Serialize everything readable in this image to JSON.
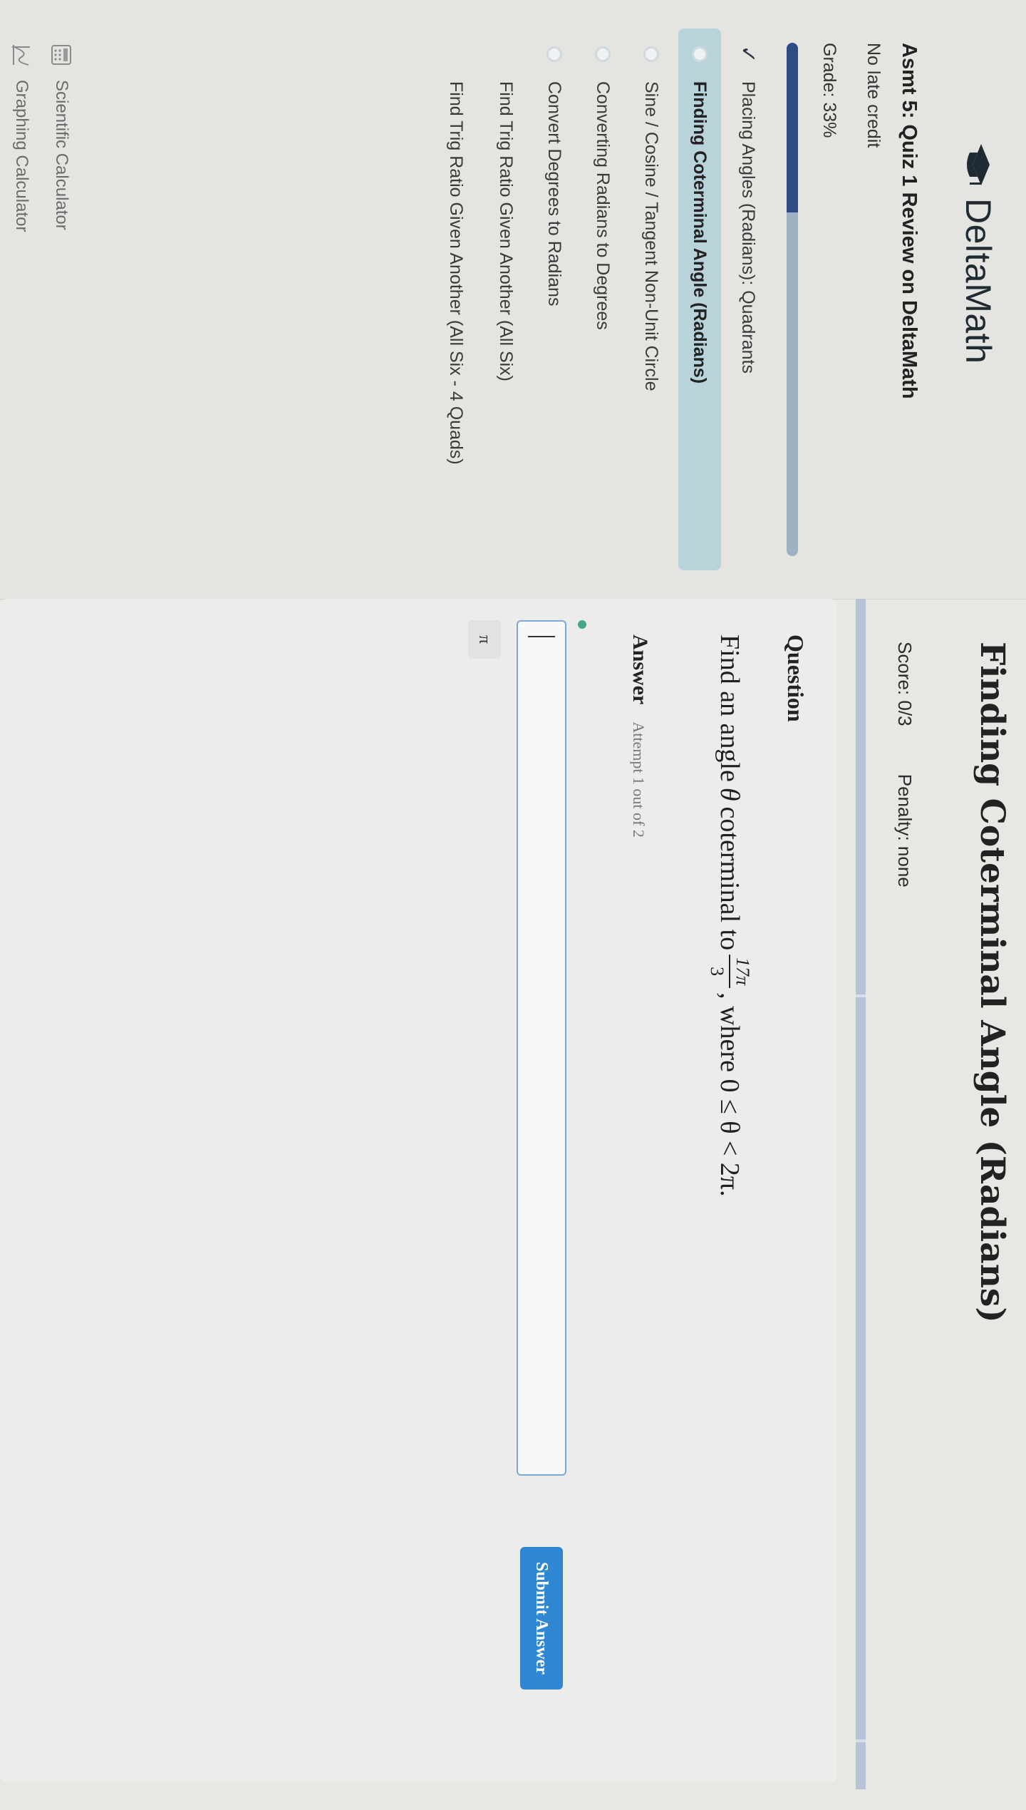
{
  "app": {
    "name": "DeltaMath"
  },
  "sidebar": {
    "assignment_title": "Asmt 5: Quiz 1 Review on DeltaMath",
    "late_credit": "No late credit",
    "grade_text": "Grade: 33%",
    "grade_fraction": 0.33,
    "skills": [
      {
        "label": "Placing Angles (Radians): Quadrants",
        "status": "complete"
      },
      {
        "label": "Finding Coterminal Angle (Radians)",
        "status": "current"
      },
      {
        "label": "Sine / Cosine / Tangent Non-Unit Circle",
        "status": "incomplete"
      },
      {
        "label": "Converting Radians to Degrees",
        "status": "incomplete"
      },
      {
        "label": "Convert Degrees to Radians",
        "status": "incomplete"
      },
      {
        "label": "Find Trig Ratio Given Another (All Six)",
        "status": "incomplete"
      },
      {
        "label": "Find Trig Ratio Given Another (All Six - 4 Quads)",
        "status": "incomplete"
      }
    ],
    "tools": [
      {
        "label": "Scientific Calculator",
        "icon": "calculator-icon"
      },
      {
        "label": "Graphing Calculator",
        "icon": "graph-icon"
      }
    ]
  },
  "main": {
    "title": "Finding Coterminal Angle (Radians)",
    "score": "Score: 0/3",
    "penalty": "Penalty: none",
    "question_label": "Question",
    "question": {
      "prefix": "Find an angle",
      "theta": "θ",
      "middle": "coterminal to",
      "fraction_numerator": "17π",
      "fraction_denominator": "3",
      "suffix": ", where 0 ≤ θ < 2π."
    },
    "answer_label": "Answer",
    "attempt_text": "Attempt 1 out of 2",
    "answer_value": "",
    "pi_key": "π",
    "submit_label": "Submit Answer"
  },
  "colors": {
    "accent": "#2f86d3",
    "active_skill_bg": "#b9d3da",
    "grade_fill": "#2e4b86",
    "status_dot": "#48a58a"
  }
}
